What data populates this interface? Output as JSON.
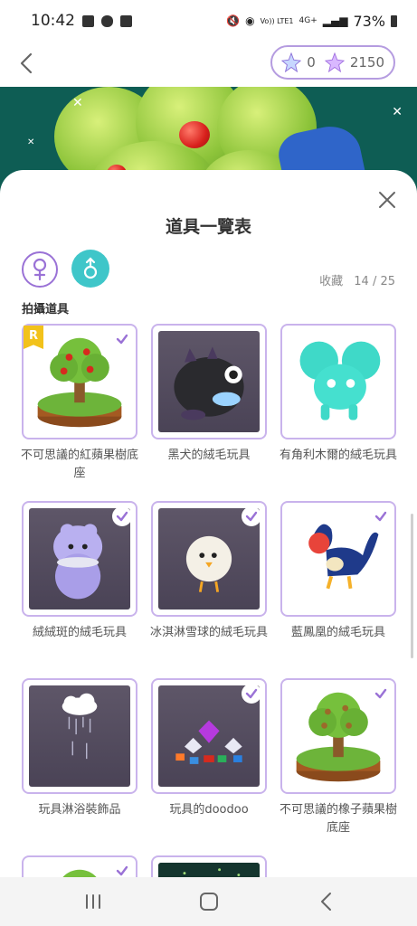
{
  "status_bar": {
    "time": "10:42",
    "battery": "73%",
    "net_label": "4G+",
    "volte_label": "Vo)) LTE1"
  },
  "top_bar": {
    "gem_count": "0",
    "star_count": "2150"
  },
  "sheet": {
    "title": "道具一覽表",
    "collection_label": "收藏",
    "collection_count": "14 / 25",
    "section_label": "拍攝道具"
  },
  "items": [
    {
      "name": "不可思議的紅蘋果樹底座",
      "rarity": "R",
      "checked": true,
      "bg": "light",
      "icon": "apple-tree-pedestal-icon"
    },
    {
      "name": "黑犬的絨毛玩具",
      "checked": false,
      "bg": "dark",
      "icon": "black-dog-plush-icon"
    },
    {
      "name": "有角利木爾的絨毛玩具",
      "checked": false,
      "bg": "light",
      "icon": "horned-plush-icon"
    },
    {
      "name": "絨絨斑的絨毛玩具",
      "checked": true,
      "bg": "dark",
      "icon": "purple-cat-plush-icon"
    },
    {
      "name": "冰淇淋雪球的絨毛玩具",
      "checked": true,
      "bg": "dark",
      "icon": "white-chick-plush-icon"
    },
    {
      "name": "藍鳳凰的絨毛玩具",
      "checked": true,
      "bg": "light",
      "icon": "blue-phoenix-plush-icon"
    },
    {
      "name": "玩具淋浴裝飾品",
      "checked": false,
      "bg": "dark",
      "icon": "rain-cloud-decor-icon"
    },
    {
      "name": "玩具的doodoo",
      "checked": true,
      "bg": "dark",
      "icon": "gems-pile-icon"
    },
    {
      "name": "不可思議的橡子蘋果樹底座",
      "checked": true,
      "bg": "light",
      "icon": "acorn-tree-pedestal-icon"
    },
    {
      "name": "",
      "checked": true,
      "bg": "light",
      "icon": "tree-partial-icon"
    },
    {
      "name": "",
      "checked": false,
      "bg": "dark",
      "icon": "dark-scene-partial-icon"
    }
  ],
  "colors": {
    "accent": "#9a72d6",
    "card_border": "#c9b3ec",
    "teal": "#3fc6c9",
    "banner": "#0e5d54",
    "rarity": "#f2c21b"
  }
}
